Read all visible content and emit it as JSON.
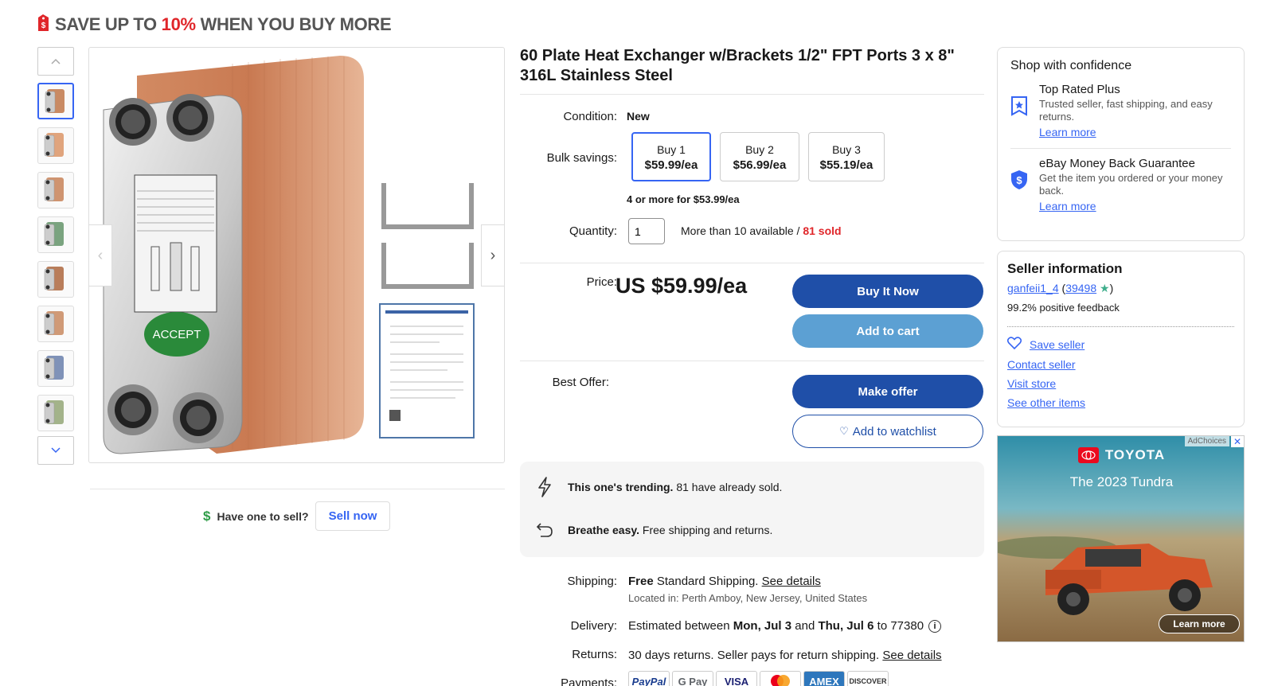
{
  "promo": {
    "prefix": "SAVE UP TO ",
    "percent": "10%",
    "suffix": " WHEN YOU BUY MORE"
  },
  "gallery": {
    "thumbnail_count": 8,
    "selected_index": 0
  },
  "sell": {
    "prompt": "Have one to sell?",
    "button": "Sell now"
  },
  "listing": {
    "title": "60 Plate Heat Exchanger w/Brackets 1/2\" FPT Ports 3 x 8\" 316L Stainless Steel",
    "condition_label": "Condition:",
    "condition_value": "New",
    "bulk_label": "Bulk savings:",
    "bulk_options": [
      {
        "qty": "Buy 1",
        "price": "$59.99/ea"
      },
      {
        "qty": "Buy 2",
        "price": "$56.99/ea"
      },
      {
        "qty": "Buy 3",
        "price": "$55.19/ea"
      }
    ],
    "bulk_note": "4 or more for $53.99/ea",
    "quantity_label": "Quantity:",
    "quantity_value": "1",
    "available_text": "More than 10 available / ",
    "sold_text": "81 sold",
    "price_label": "Price:",
    "price": "US $59.99/ea",
    "buy_now": "Buy It Now",
    "add_to_cart": "Add to cart",
    "best_offer_label": "Best Offer:",
    "make_offer": "Make offer",
    "add_to_watchlist": "Add to watchlist"
  },
  "highlights": [
    {
      "icon": "lightning-icon",
      "bold": "This one's trending.",
      "text": " 81 have already sold."
    },
    {
      "icon": "return-arrow-icon",
      "bold": "Breathe easy.",
      "text": " Free shipping and returns."
    }
  ],
  "shipping": {
    "label": "Shipping:",
    "free": "Free",
    "text": " Standard Shipping. ",
    "link": "See details",
    "location": "Located in: Perth Amboy, New Jersey, United States"
  },
  "delivery": {
    "label": "Delivery:",
    "pre": "Estimated between ",
    "date1": "Mon, Jul 3",
    "mid": " and ",
    "date2": "Thu, Jul 6",
    "post": " to 77380"
  },
  "returns": {
    "label": "Returns:",
    "text": "30 days returns. Seller pays for return shipping. ",
    "link": "See details"
  },
  "payments": {
    "label": "Payments:",
    "methods": [
      "PayPal",
      "G Pay",
      "VISA",
      "Mastercard",
      "AMEX",
      "DISCOVER"
    ]
  },
  "confidence": {
    "title": "Shop with confidence",
    "items": [
      {
        "icon": "star-badge-icon",
        "heading": "Top Rated Plus",
        "desc": "Trusted seller, fast shipping, and easy returns.",
        "link": "Learn more"
      },
      {
        "icon": "dollar-shield-icon",
        "heading": "eBay Money Back Guarantee",
        "desc": "Get the item you ordered or your money back.",
        "link": "Learn more"
      }
    ]
  },
  "seller": {
    "title": "Seller information",
    "name": "ganfeii1_4",
    "score": "39498",
    "feedback": "99.2% positive feedback",
    "save": "Save seller",
    "contact": "Contact seller",
    "store": "Visit store",
    "other": "See other items"
  },
  "ad": {
    "adchoices": "AdChoices",
    "brand": "TOYOTA",
    "headline": "The 2023 Tundra",
    "cta": "Learn more"
  },
  "colors": {
    "accent": "#3665f3",
    "primary_button": "#1f4fa8",
    "secondary_button": "#5ca0d3",
    "sold_red": "#e0262a",
    "toyota_red": "#eb0a1e"
  }
}
